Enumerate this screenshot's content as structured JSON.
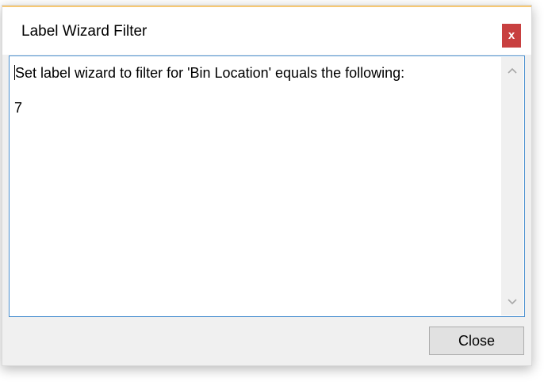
{
  "window": {
    "title": "Label Wizard Filter",
    "close_glyph": "x",
    "accent_color": "#f7c873",
    "close_color": "#c84040"
  },
  "textbox": {
    "lines": [
      "Set label wizard to filter for 'Bin Location' equals the following:",
      "",
      "7"
    ],
    "border_color": "#4a90d0"
  },
  "scrollbar": {
    "up_icon": "chevron-up-icon",
    "down_icon": "chevron-down-icon"
  },
  "footer": {
    "close_label": "Close"
  }
}
